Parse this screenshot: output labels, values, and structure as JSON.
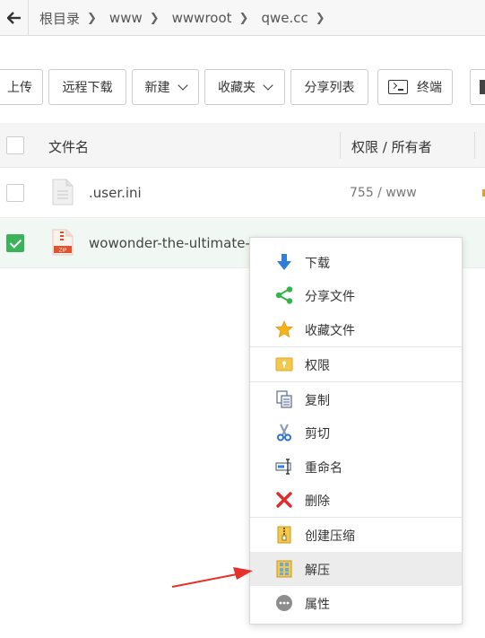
{
  "breadcrumb": {
    "items": [
      "根目录",
      "www",
      "wwwroot",
      "qwe.cc"
    ]
  },
  "toolbar": {
    "upload": "上传",
    "remote_download": "远程下载",
    "new": "新建",
    "favorites": "收藏夹",
    "share_list": "分享列表",
    "terminal": "终端"
  },
  "table": {
    "headers": {
      "name": "文件名",
      "perm": "权限 / 所有者"
    },
    "rows": [
      {
        "name": ".user.ini",
        "perm": "755 / www",
        "checked": false,
        "type": "text"
      },
      {
        "name": "wowonder-the-ultimate-",
        "perm": "",
        "checked": true,
        "type": "zip"
      }
    ]
  },
  "context_menu": {
    "items": [
      {
        "label": "下载",
        "icon": "download-icon"
      },
      {
        "label": "分享文件",
        "icon": "share-icon"
      },
      {
        "label": "收藏文件",
        "icon": "star-icon"
      },
      {
        "label": "权限",
        "icon": "permission-icon"
      },
      {
        "label": "复制",
        "icon": "copy-icon"
      },
      {
        "label": "剪切",
        "icon": "scissors-icon"
      },
      {
        "label": "重命名",
        "icon": "rename-icon"
      },
      {
        "label": "删除",
        "icon": "delete-icon"
      },
      {
        "label": "创建压缩",
        "icon": "compress-icon"
      },
      {
        "label": "解压",
        "icon": "extract-icon",
        "highlighted": true
      },
      {
        "label": "属性",
        "icon": "properties-icon"
      }
    ]
  },
  "colors": {
    "accent_green": "#3bb35a",
    "annotation_red": "#e8302a"
  }
}
